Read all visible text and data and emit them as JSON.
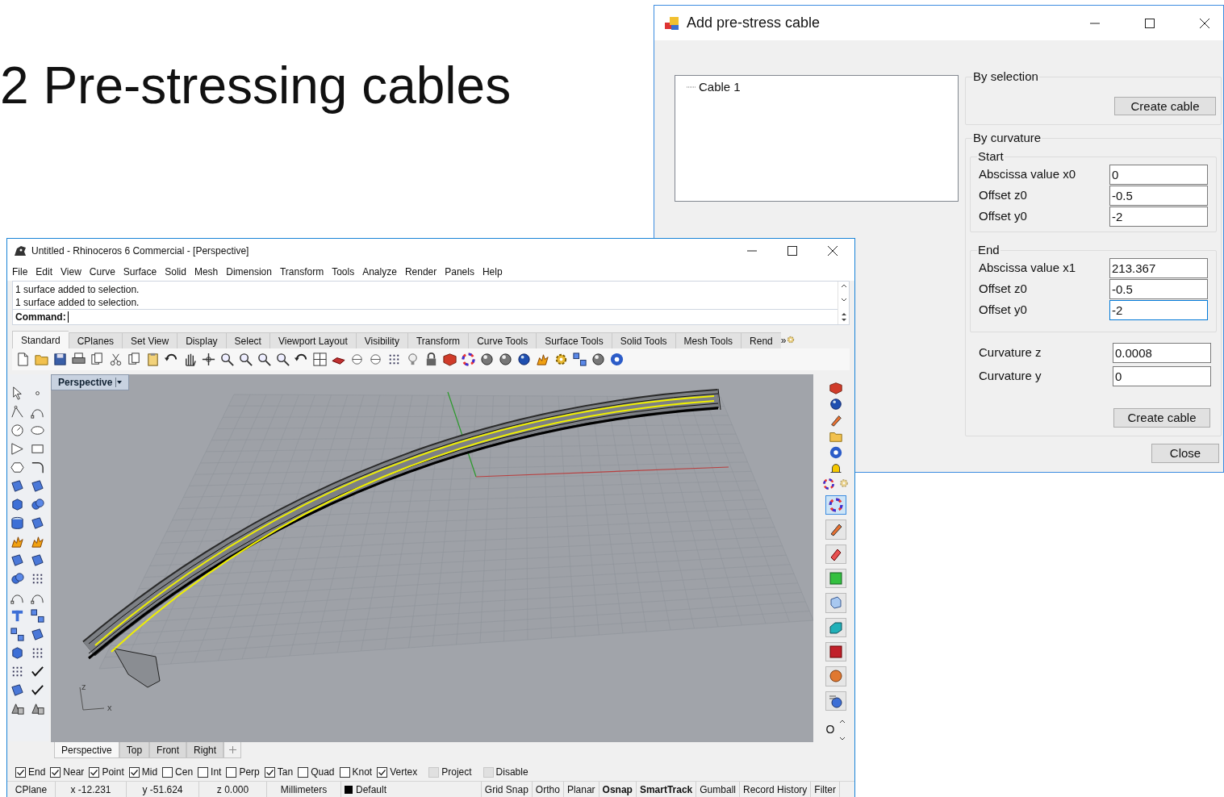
{
  "slide": {
    "title": "2 Pre-stressing cables"
  },
  "dialog": {
    "title": "Add pre-stress cable",
    "tree": [
      {
        "label": "Cable 1"
      }
    ],
    "by_selection": {
      "label": "By selection",
      "button": "Create cable"
    },
    "by_curvature": {
      "label": "By curvature",
      "start": {
        "label": "Start",
        "fields": [
          {
            "label": "Abscissa value x0",
            "value": "0",
            "focused": false
          },
          {
            "label": "Offset z0",
            "value": "-0.5",
            "focused": false
          },
          {
            "label": "Offset y0",
            "value": "-2",
            "focused": false
          }
        ]
      },
      "end": {
        "label": "End",
        "fields": [
          {
            "label": "Abscissa value x1",
            "value": "213.367",
            "focused": false
          },
          {
            "label": "Offset z0",
            "value": "-0.5",
            "focused": false
          },
          {
            "label": "Offset y0",
            "value": "-2",
            "focused": true
          }
        ]
      },
      "fields": [
        {
          "label": "Curvature z",
          "value": "0.0008",
          "focused": false
        },
        {
          "label": "Curvature y",
          "value": "0",
          "focused": false
        }
      ],
      "button": "Create cable"
    },
    "close_button": "Close"
  },
  "rhino": {
    "title": "Untitled - Rhinoceros 6 Commercial - [Perspective]",
    "menu": [
      "File",
      "Edit",
      "View",
      "Curve",
      "Surface",
      "Solid",
      "Mesh",
      "Dimension",
      "Transform",
      "Tools",
      "Analyze",
      "Render",
      "Panels",
      "Help"
    ],
    "history": [
      "1 surface added to selection.",
      "1 surface added to selection."
    ],
    "command_label": "Command:",
    "toolbar_tabs": [
      {
        "label": "Standard",
        "selected": true
      },
      {
        "label": "CPlanes",
        "selected": false
      },
      {
        "label": "Set View",
        "selected": false
      },
      {
        "label": "Display",
        "selected": false
      },
      {
        "label": "Select",
        "selected": false
      },
      {
        "label": "Viewport Layout",
        "selected": false
      },
      {
        "label": "Visibility",
        "selected": false
      },
      {
        "label": "Transform",
        "selected": false
      },
      {
        "label": "Curve Tools",
        "selected": false
      },
      {
        "label": "Surface Tools",
        "selected": false
      },
      {
        "label": "Solid Tools",
        "selected": false
      },
      {
        "label": "Mesh Tools",
        "selected": false
      },
      {
        "label": "Rend",
        "selected": false
      }
    ],
    "tabs_overflow": "»",
    "viewport": {
      "label": "Perspective",
      "axis_labels": [
        "z",
        "x"
      ]
    },
    "side_panel_label": "O",
    "viewport_tabs": [
      {
        "label": "Perspective",
        "selected": true
      },
      {
        "label": "Top",
        "selected": false
      },
      {
        "label": "Front",
        "selected": false
      },
      {
        "label": "Right",
        "selected": false
      }
    ],
    "osnaps": [
      {
        "label": "End",
        "checked": true,
        "disabled": false
      },
      {
        "label": "Near",
        "checked": true,
        "disabled": false
      },
      {
        "label": "Point",
        "checked": true,
        "disabled": false
      },
      {
        "label": "Mid",
        "checked": true,
        "disabled": false
      },
      {
        "label": "Cen",
        "checked": false,
        "disabled": false
      },
      {
        "label": "Int",
        "checked": false,
        "disabled": false
      },
      {
        "label": "Perp",
        "checked": false,
        "disabled": false
      },
      {
        "label": "Tan",
        "checked": true,
        "disabled": false
      },
      {
        "label": "Quad",
        "checked": false,
        "disabled": false
      },
      {
        "label": "Knot",
        "checked": false,
        "disabled": false
      },
      {
        "label": "Vertex",
        "checked": true,
        "disabled": false
      },
      {
        "label": "Project",
        "checked": false,
        "disabled": true
      },
      {
        "label": "Disable",
        "checked": false,
        "disabled": true
      }
    ],
    "status": [
      {
        "text": "CPlane",
        "kind": "plain",
        "bold": false
      },
      {
        "text": "x -12.231",
        "kind": "plain",
        "bold": false
      },
      {
        "text": "y -51.624",
        "kind": "plain",
        "bold": false
      },
      {
        "text": "z 0.000",
        "kind": "plain",
        "bold": false
      },
      {
        "text": "Millimeters",
        "kind": "plain",
        "bold": false
      },
      {
        "text": "Default",
        "kind": "layer",
        "bold": false
      },
      {
        "text": "Grid Snap",
        "kind": "toggle",
        "bold": false
      },
      {
        "text": "Ortho",
        "kind": "toggle",
        "bold": false
      },
      {
        "text": "Planar",
        "kind": "toggle",
        "bold": false
      },
      {
        "text": "Osnap",
        "kind": "toggle",
        "bold": true
      },
      {
        "text": "SmartTrack",
        "kind": "toggle",
        "bold": true
      },
      {
        "text": "Gumball",
        "kind": "toggle",
        "bold": false
      },
      {
        "text": "Record History",
        "kind": "toggle",
        "bold": false
      },
      {
        "text": "Filter",
        "kind": "toggle",
        "bold": false
      }
    ]
  }
}
